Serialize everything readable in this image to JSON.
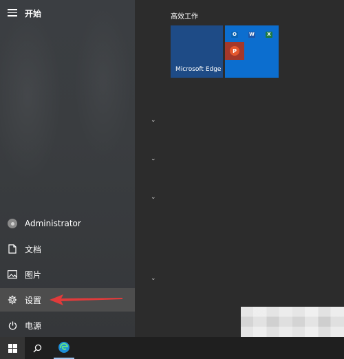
{
  "start_menu": {
    "title": "开始",
    "user": "Administrator",
    "items": [
      {
        "label": "文档",
        "icon": "document-icon"
      },
      {
        "label": "图片",
        "icon": "picture-icon"
      },
      {
        "label": "设置",
        "icon": "gear-icon"
      },
      {
        "label": "电源",
        "icon": "power-icon"
      }
    ]
  },
  "tiles": {
    "group_label": "高效工作",
    "edge_label": "Microsoft Edge"
  },
  "colors": {
    "arrow": "#e03b3b",
    "edge_tile": "#1e4b86",
    "office_tile": "#0c6ecf"
  }
}
